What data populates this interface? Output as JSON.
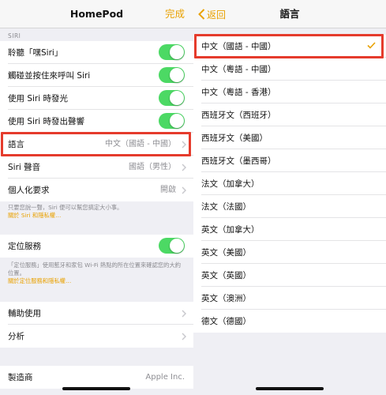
{
  "left": {
    "nav": {
      "title": "HomePod",
      "done_label": "完成"
    },
    "siri_section_label": "SIRI",
    "toggles": [
      {
        "label": "聆聽「嘿Siri」",
        "on": true
      },
      {
        "label": "觸碰並按住來呼叫 Siri",
        "on": true
      },
      {
        "label": "使用 Siri 時發光",
        "on": true
      },
      {
        "label": "使用 Siri 時發出聲響",
        "on": true
      }
    ],
    "settings": [
      {
        "label": "語言",
        "value": "中文（國語 - 中國）"
      },
      {
        "label": "Siri 聲音",
        "value": "國語（男性）"
      },
      {
        "label": "個人化要求",
        "value": "開啟"
      }
    ],
    "siri_note": {
      "text": "只要您說一聲，Siri 便可以幫您搞定大小事。",
      "link": "關於 Siri 和隱私權…"
    },
    "location": {
      "label": "定位服務",
      "on": true
    },
    "location_note": {
      "text": "「定位服務」使用藍牙和家包 Wi-Fi 熱點的所在位置來確認您的大約位置。",
      "link": "關於定位服務和隱私權…"
    },
    "more": [
      {
        "label": "輔助使用"
      },
      {
        "label": "分析"
      }
    ],
    "manufacturer": {
      "label": "製造商",
      "value": "Apple Inc."
    }
  },
  "right": {
    "nav": {
      "back_label": "返回",
      "title": "語言"
    },
    "languages": [
      "中文（國語 - 中國）",
      "中文（粵語 - 中國）",
      "中文（粵語 - 香港）",
      "西班牙文（西班牙）",
      "西班牙文（美國）",
      "西班牙文（墨西哥）",
      "法文（加拿大）",
      "法文（法國）",
      "英文（加拿大）",
      "英文（美國）",
      "英文（英國）",
      "英文（澳洲）",
      "德文（德國）"
    ],
    "selected_index": 0
  },
  "colors": {
    "accent": "#e9a100",
    "toggle_on": "#4cd964",
    "highlight": "#e53b2c"
  }
}
